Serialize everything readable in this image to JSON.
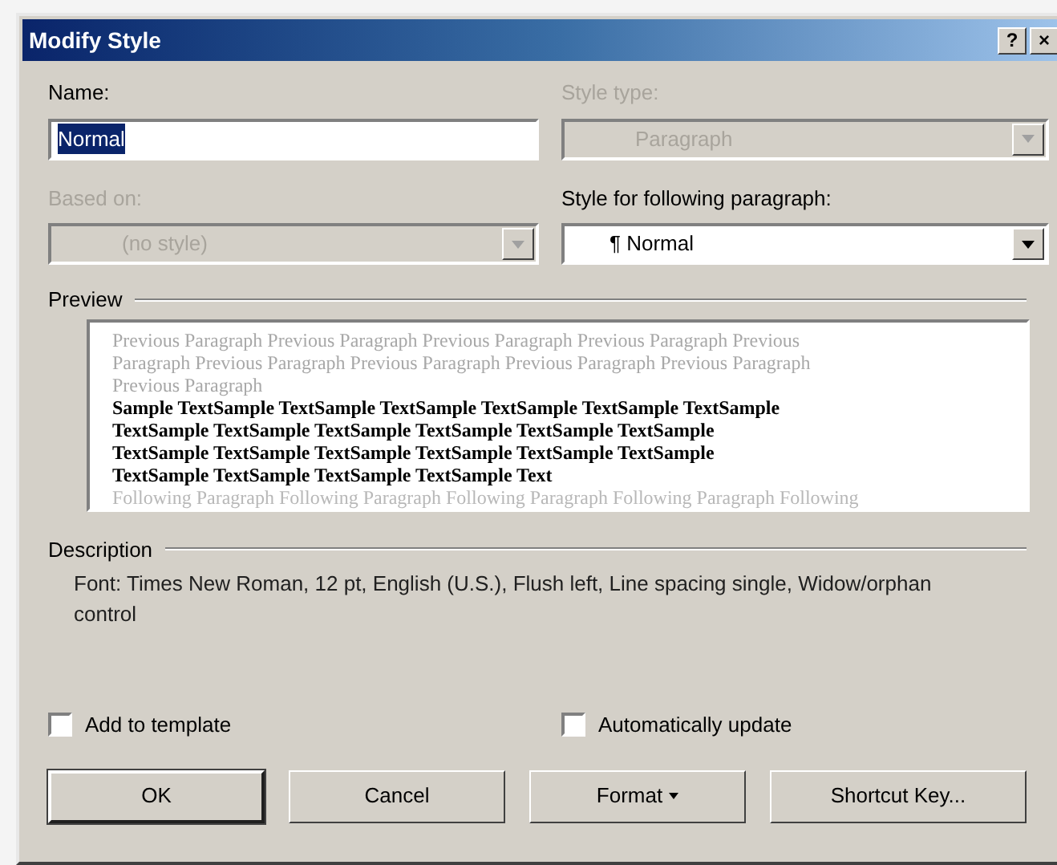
{
  "window": {
    "title": "Modify Style",
    "help_button": "?",
    "close_button": "×"
  },
  "name": {
    "label": "Name:",
    "value": "Normal",
    "disabled": false,
    "selected": true
  },
  "style_type": {
    "label": "Style type:",
    "value": "Paragraph",
    "disabled": true
  },
  "based_on": {
    "label": "Based on:",
    "value": "(no style)",
    "disabled": true
  },
  "following": {
    "label": "Style for following paragraph:",
    "value": "¶ Normal",
    "disabled": false
  },
  "preview": {
    "label": "Preview",
    "lines": [
      {
        "kind": "previous",
        "text": "Previous Paragraph Previous Paragraph Previous Paragraph Previous Paragraph Previous"
      },
      {
        "kind": "previous",
        "text": "Paragraph Previous Paragraph Previous Paragraph Previous Paragraph Previous Paragraph"
      },
      {
        "kind": "previous",
        "text": "Previous Paragraph"
      },
      {
        "kind": "sample",
        "text": "Sample TextSample TextSample TextSample TextSample TextSample TextSample"
      },
      {
        "kind": "sample",
        "text": "TextSample TextSample TextSample TextSample TextSample TextSample"
      },
      {
        "kind": "sample",
        "text": "TextSample TextSample TextSample TextSample TextSample TextSample"
      },
      {
        "kind": "sample",
        "text": "TextSample TextSample TextSample TextSample Text"
      },
      {
        "kind": "following",
        "text": "Following Paragraph Following Paragraph Following Paragraph Following Paragraph Following"
      }
    ]
  },
  "description": {
    "label": "Description",
    "text": "Font: Times New Roman, 12 pt, English (U.S.), Flush left, Line spacing single, Widow/orphan control"
  },
  "checkboxes": [
    {
      "label": "Add to template",
      "checked": false
    },
    {
      "label": "Automatically update",
      "checked": false
    }
  ],
  "buttons": [
    {
      "label": "OK",
      "kind": "default"
    },
    {
      "label": "Cancel",
      "kind": "plain"
    },
    {
      "label": "Format",
      "kind": "menu"
    },
    {
      "label": "Shortcut Key...",
      "kind": "plain"
    }
  ]
}
